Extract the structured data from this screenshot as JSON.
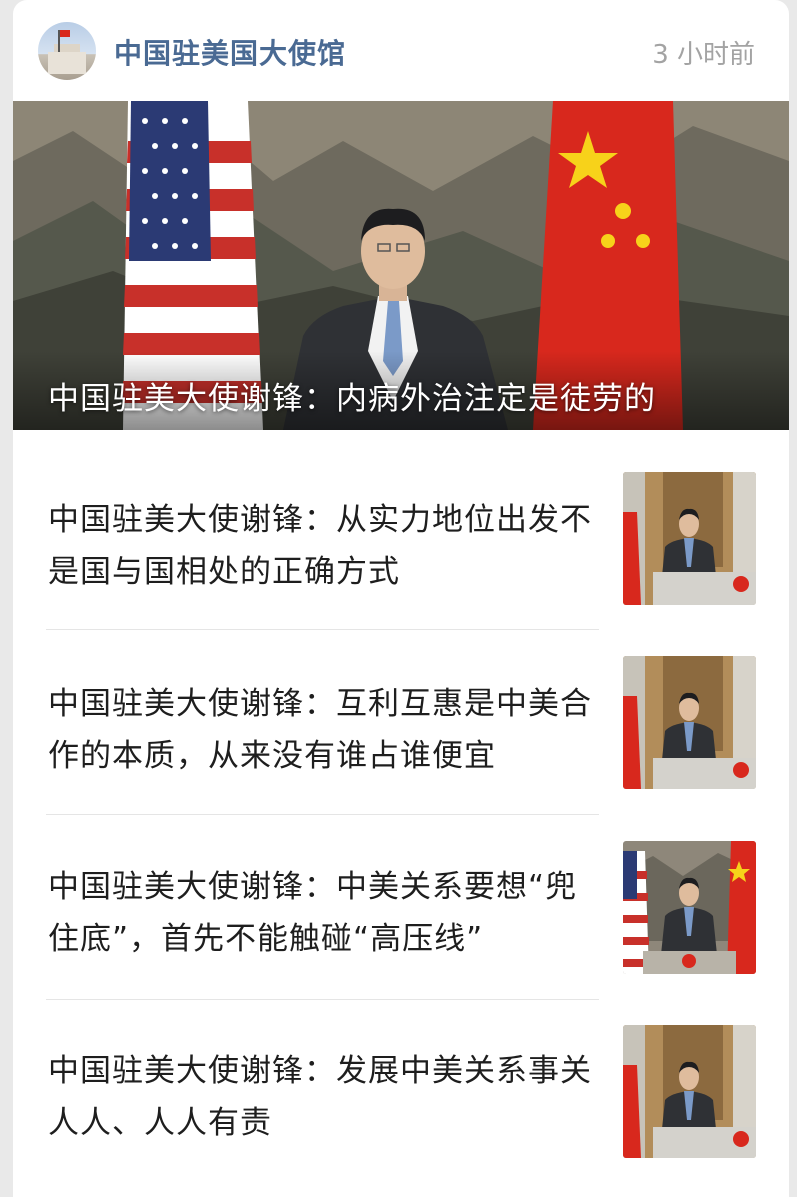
{
  "header": {
    "account_name": "中国驻美国大使馆",
    "time": "3 小时前",
    "avatar_icon": "embassy-building-avatar"
  },
  "hero": {
    "title": "中国驻美大使谢锋：内病外治注定是徒劳的"
  },
  "articles": [
    {
      "title": "中国驻美大使谢锋：从实力地位出发不是国与国相处的正确方式",
      "thumb": "ambassador-podium-photo"
    },
    {
      "title": "中国驻美大使谢锋：互利互惠是中美合作的本质，从来没有谁占谁便宜",
      "thumb": "ambassador-podium-photo"
    },
    {
      "title": "中国驻美大使谢锋：中美关系要想“兜住底”，首先不能触碰“高压线”",
      "thumb": "ambassador-flags-photo"
    },
    {
      "title": "中国驻美大使谢锋：发展中美关系事关人人、人人有责",
      "thumb": "ambassador-podium-photo"
    }
  ],
  "colors": {
    "account_name": "#4a6a93",
    "time": "#a3a3a3",
    "title": "#1e1e1e",
    "flag_red": "#d8281d",
    "flag_yellow": "#f7d21a"
  }
}
